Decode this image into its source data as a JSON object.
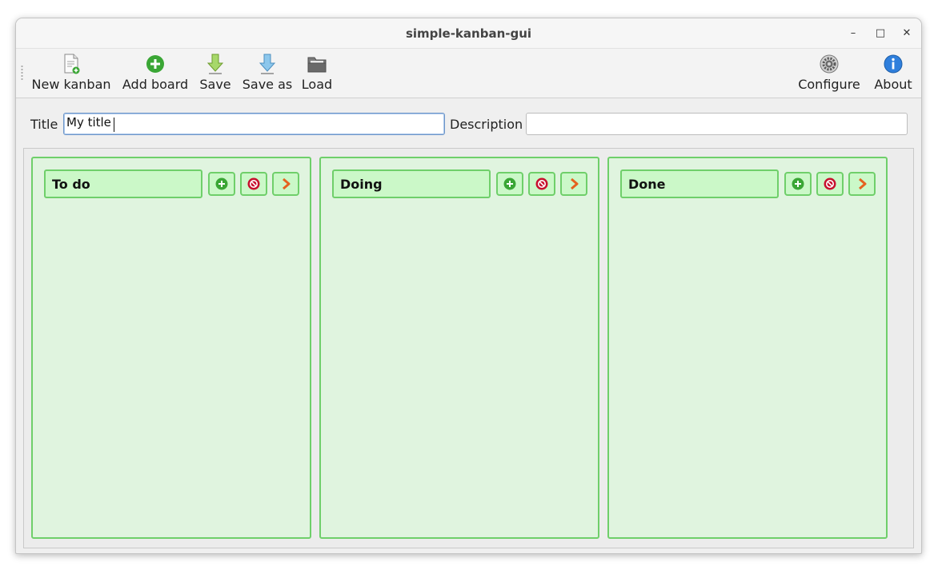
{
  "window": {
    "title": "simple-kanban-gui",
    "minimize_glyph": "–",
    "maximize_glyph": "□",
    "close_glyph": "✕"
  },
  "toolbar": {
    "items": [
      {
        "label": "New kanban",
        "icon": "new-document-icon"
      },
      {
        "label": "Add board",
        "icon": "add-circle-icon"
      },
      {
        "label": "Save",
        "icon": "save-arrow-icon"
      },
      {
        "label": "Save as",
        "icon": "save-as-arrow-icon"
      },
      {
        "label": "Load",
        "icon": "folder-icon"
      }
    ],
    "right_items": [
      {
        "label": "Configure",
        "icon": "gear-icon"
      },
      {
        "label": "About",
        "icon": "info-icon"
      }
    ]
  },
  "form": {
    "title_label": "Title",
    "title_value": "My title",
    "description_label": "Description",
    "description_value": ""
  },
  "boards": [
    {
      "title": "To do"
    },
    {
      "title": "Doing"
    },
    {
      "title": "Done"
    }
  ],
  "colors": {
    "column_bg": "#e0f4df",
    "column_border": "#6fcf6a",
    "title_bg": "#cbf8c8",
    "add_green": "#3aa635",
    "remove_red": "#c8102e",
    "arrow_orange": "#e5621f"
  }
}
